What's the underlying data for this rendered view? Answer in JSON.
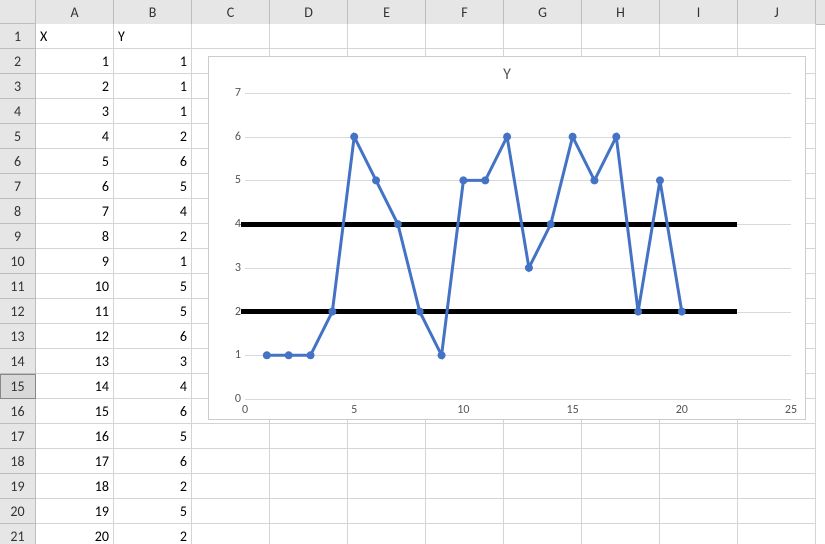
{
  "columns": [
    "A",
    "B",
    "C",
    "D",
    "E",
    "F",
    "G",
    "H",
    "I",
    "J"
  ],
  "header": {
    "x_label": "X",
    "y_label": "Y"
  },
  "rows": [
    {
      "x": 1,
      "y": 1
    },
    {
      "x": 2,
      "y": 1
    },
    {
      "x": 3,
      "y": 1
    },
    {
      "x": 4,
      "y": 2
    },
    {
      "x": 5,
      "y": 6
    },
    {
      "x": 6,
      "y": 5
    },
    {
      "x": 7,
      "y": 4
    },
    {
      "x": 8,
      "y": 2
    },
    {
      "x": 9,
      "y": 1
    },
    {
      "x": 10,
      "y": 5
    },
    {
      "x": 11,
      "y": 5
    },
    {
      "x": 12,
      "y": 6
    },
    {
      "x": 13,
      "y": 3
    },
    {
      "x": 14,
      "y": 4
    },
    {
      "x": 15,
      "y": 6
    },
    {
      "x": 16,
      "y": 5
    },
    {
      "x": 17,
      "y": 6
    },
    {
      "x": 18,
      "y": 2
    },
    {
      "x": 19,
      "y": 5
    },
    {
      "x": 20,
      "y": 2
    }
  ],
  "selected_row_header": 15,
  "chart_data": {
    "type": "line",
    "title": "Y",
    "xlabel": "",
    "ylabel": "",
    "xlim": [
      0,
      25
    ],
    "ylim": [
      0,
      7
    ],
    "xticks": [
      0,
      5,
      10,
      15,
      20,
      25
    ],
    "yticks": [
      0,
      1,
      2,
      3,
      4,
      5,
      6,
      7
    ],
    "x": [
      1,
      2,
      3,
      4,
      5,
      6,
      7,
      8,
      9,
      10,
      11,
      12,
      13,
      14,
      15,
      16,
      17,
      18,
      19,
      20
    ],
    "y": [
      1,
      1,
      1,
      2,
      6,
      5,
      4,
      2,
      1,
      5,
      5,
      6,
      3,
      4,
      6,
      5,
      6,
      2,
      5,
      2
    ],
    "horizontal_bands": [
      2,
      4
    ],
    "band_xrange": [
      0,
      22
    ],
    "colors": {
      "series": "#4472C4",
      "grid": "#d9d9d9",
      "band": "#000000"
    }
  }
}
